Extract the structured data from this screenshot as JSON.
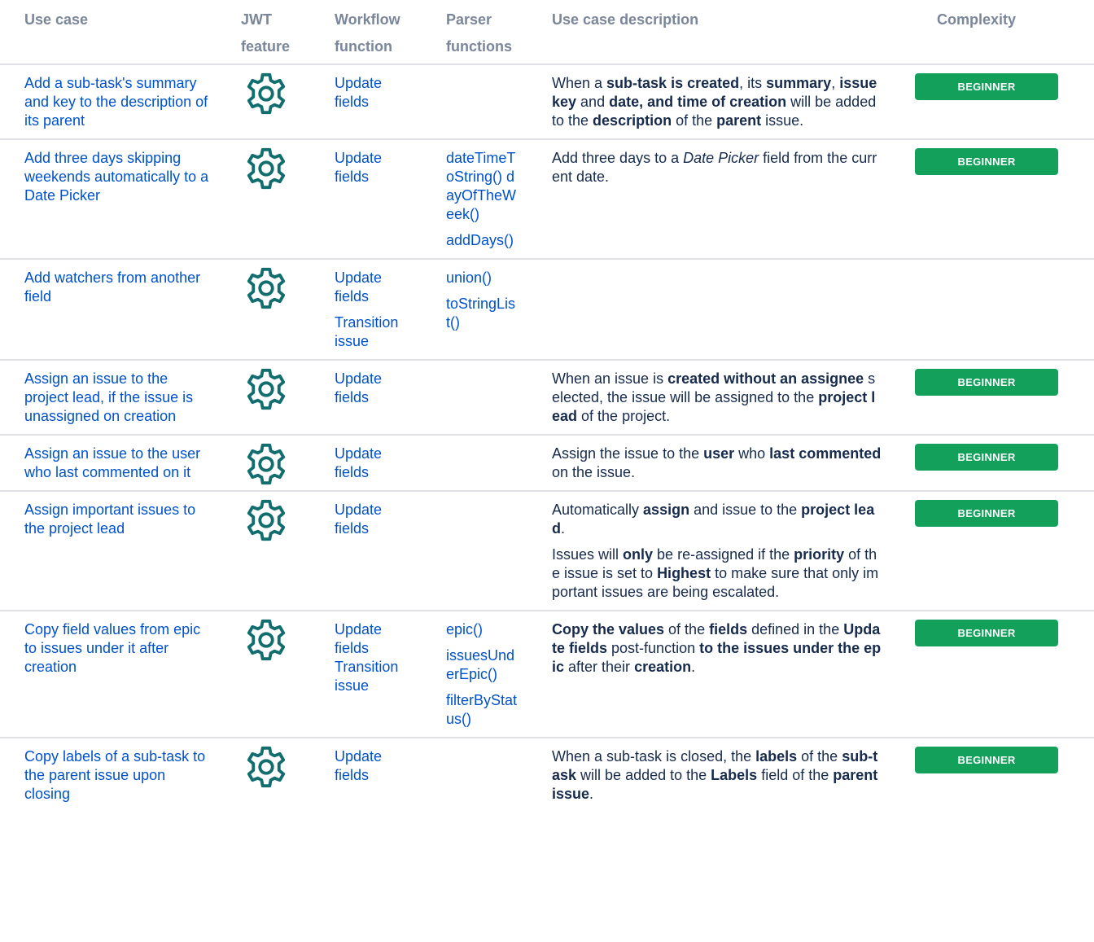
{
  "headers": {
    "use_case": "Use case",
    "jwt_feature": "JWT feature",
    "workflow_function": "Workflow function",
    "parser_functions": "Parser functions",
    "description": "Use case description",
    "complexity": "Complexity"
  },
  "icon": "gear-icon",
  "colors": {
    "link": "#0052cc",
    "badge": "#12a05a",
    "icon": "#126e6e",
    "header": "#7a869a"
  },
  "rows": [
    {
      "use_case": "Add a sub-task's summary and key to the description of its parent",
      "workflow": [
        "Update fields"
      ],
      "parser": [],
      "description": [
        [
          [
            "When a ",
            false
          ],
          [
            "sub-task is created",
            true
          ],
          [
            ", its ",
            false
          ],
          [
            "summary",
            true
          ],
          [
            ", ",
            false
          ],
          [
            "issue key",
            true
          ],
          [
            " and ",
            false
          ],
          [
            "date, and time of creation",
            true
          ],
          [
            " will be added to the ",
            false
          ],
          [
            "description",
            true
          ],
          [
            " of the ",
            false
          ],
          [
            "parent",
            true
          ],
          [
            " issue.",
            false
          ]
        ]
      ],
      "complexity": "BEGINNER"
    },
    {
      "use_case": "Add three days skipping weekends automatically to a Date Picker",
      "workflow": [
        "Update fields"
      ],
      "parser": [
        "dateTimeToString() dayOfTheWeek()",
        "addDays()"
      ],
      "description": [
        [
          [
            "Add three days to a ",
            false
          ],
          [
            "Date Picker",
            "i"
          ],
          [
            " field from the current date.",
            false
          ]
        ]
      ],
      "complexity": "BEGINNER"
    },
    {
      "use_case": "Add watchers from another field",
      "workflow": [
        "Update fields",
        "Transition issue"
      ],
      "parser": [
        "union()",
        "toStringList()"
      ],
      "description": [],
      "complexity": ""
    },
    {
      "use_case": "Assign an issue to the project lead, if the issue is unassigned on creation",
      "workflow": [
        "Update fields"
      ],
      "parser": [],
      "description": [
        [
          [
            "When an issue is ",
            false
          ],
          [
            "created without an assignee",
            true
          ],
          [
            " selected, the issue will be assigned to the ",
            false
          ],
          [
            "project lead",
            true
          ],
          [
            " of the project.",
            false
          ]
        ]
      ],
      "complexity": "BEGINNER"
    },
    {
      "use_case": "Assign an issue to the user who last commented on it",
      "workflow": [
        "Update fields"
      ],
      "parser": [],
      "description": [
        [
          [
            "Assign the issue to the ",
            false
          ],
          [
            "user",
            true
          ],
          [
            " who ",
            false
          ],
          [
            "last commented",
            true
          ],
          [
            " on the issue.",
            false
          ]
        ]
      ],
      "complexity": "BEGINNER"
    },
    {
      "use_case": "Assign important issues to the project lead",
      "workflow": [
        "Update fields"
      ],
      "parser": [],
      "description": [
        [
          [
            "Automatically ",
            false
          ],
          [
            "assign",
            true
          ],
          [
            " and issue to the ",
            false
          ],
          [
            "project lead",
            true
          ],
          [
            ".",
            false
          ]
        ],
        [
          [
            "Issues will ",
            false
          ],
          [
            "only",
            true
          ],
          [
            " be re-assigned if the ",
            false
          ],
          [
            "priority",
            true
          ],
          [
            " of the issue is set to ",
            false
          ],
          [
            "Highest",
            true
          ],
          [
            " to make sure that only important issues are being escalated.",
            false
          ]
        ]
      ],
      "complexity": "BEGINNER"
    },
    {
      "use_case": "Copy field values from epic to issues under it after creation",
      "workflow": [
        "Update fields Transition issue"
      ],
      "parser": [
        "epic()",
        "issuesUnderEpic()",
        "filterByStatus()"
      ],
      "description": [
        [
          [
            "Copy the values",
            true
          ],
          [
            " of the ",
            false
          ],
          [
            "fields",
            true
          ],
          [
            " defined in the ",
            false
          ],
          [
            "Update fields",
            true
          ],
          [
            " post-function ",
            false
          ],
          [
            "to the issues under the epic",
            true
          ],
          [
            " after their ",
            false
          ],
          [
            "creation",
            true
          ],
          [
            ".",
            false
          ]
        ]
      ],
      "complexity": "BEGINNER"
    },
    {
      "use_case": "Copy labels of a sub-task to the parent issue upon closing",
      "workflow": [
        "Update fields"
      ],
      "parser": [],
      "description": [
        [
          [
            "When a sub-task is closed, the ",
            false
          ],
          [
            "labels",
            true
          ],
          [
            " of the ",
            false
          ],
          [
            "sub-task",
            true
          ],
          [
            " will be added to the ",
            false
          ],
          [
            "Labels",
            true
          ],
          [
            " field of the ",
            false
          ],
          [
            "parent issue",
            true
          ],
          [
            ".",
            false
          ]
        ]
      ],
      "complexity": "BEGINNER"
    }
  ]
}
